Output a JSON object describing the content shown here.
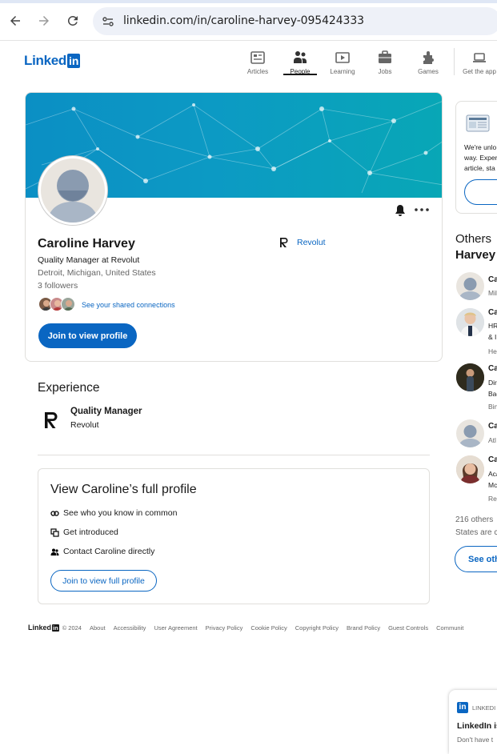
{
  "browser": {
    "url": "linkedin.com/in/caroline-harvey-095424333"
  },
  "header": {
    "logo_text": "Linked",
    "logo_box": "in",
    "nav": [
      {
        "label": "Articles",
        "icon": "articles-icon"
      },
      {
        "label": "People",
        "icon": "people-icon",
        "active": true
      },
      {
        "label": "Learning",
        "icon": "learning-icon"
      },
      {
        "label": "Jobs",
        "icon": "jobs-icon"
      },
      {
        "label": "Games",
        "icon": "games-icon"
      },
      {
        "label": "Get the app",
        "icon": "laptop-icon"
      }
    ]
  },
  "profile": {
    "name": "Caroline Harvey",
    "headline": "Quality Manager at Revolut",
    "location": "Detroit, Michigan, United States",
    "followers": "3 followers",
    "shared_connections": "See your shared connections",
    "current_company": "Revolut",
    "join_button": "Join to view profile"
  },
  "experience": {
    "title": "Experience",
    "items": [
      {
        "role": "Quality Manager",
        "company": "Revolut"
      }
    ]
  },
  "full_profile": {
    "title": "View Caroline’s full profile",
    "items": [
      {
        "icon": "people-in-common-icon",
        "text": "See who you know in common"
      },
      {
        "icon": "introduce-icon",
        "text": "Get introduced"
      },
      {
        "icon": "contact-icon",
        "text": "Contact Caroline directly"
      }
    ],
    "button": "Join to view full profile"
  },
  "footer": {
    "logo_text": "Linked",
    "logo_box": "in",
    "copyright": "© 2024",
    "links": [
      "About",
      "Accessibility",
      "User Agreement",
      "Privacy Policy",
      "Cookie Policy",
      "Copyright Policy",
      "Brand Policy",
      "Guest Controls",
      "Communit"
    ]
  },
  "right_column": {
    "promo_text": [
      "We're unlo",
      "way. Exper",
      "article, sta"
    ],
    "others_line1": "Others",
    "others_line2": "Harvey",
    "people": [
      {
        "name": "Ca",
        "lines": [
          "Mil"
        ]
      },
      {
        "name": "Ca",
        "lines": [
          "HR",
          "& I",
          "He"
        ]
      },
      {
        "name": "Ca",
        "lines": [
          "Dir",
          "Bac",
          "Bin"
        ]
      },
      {
        "name": "Ca",
        "lines": [
          "Atl"
        ]
      },
      {
        "name": "Ca",
        "lines": [
          "Aca",
          "Mc",
          "Rea"
        ]
      }
    ],
    "others_count_line1": "216 others",
    "others_count_line2": "States are c",
    "see_others": "See oth"
  },
  "toast": {
    "logo": "in",
    "brand": "LINKEDI",
    "title": "LinkedIn is",
    "body": "Don't have t"
  },
  "colors": {
    "brand": "#0a66c2",
    "banner_start": "#0b8fc4",
    "banner_end": "#08a7b6"
  }
}
